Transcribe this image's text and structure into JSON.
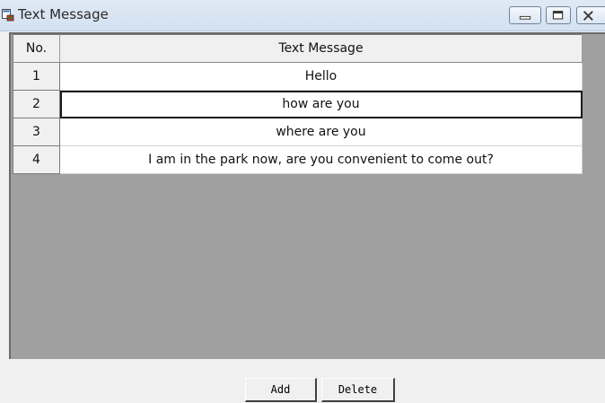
{
  "window": {
    "title": "Text Message",
    "icon": "app-window-icon"
  },
  "titlebar_buttons": {
    "minimize": "minimize-icon",
    "maximize": "maximize-icon",
    "close": "close-icon"
  },
  "table": {
    "headers": [
      "No.",
      "Text Message"
    ],
    "rows": [
      {
        "no": "1",
        "message": "Hello"
      },
      {
        "no": "2",
        "message": "how are you"
      },
      {
        "no": "3",
        "message": "where are you"
      },
      {
        "no": "4",
        "message": "I am in the park now, are you convenient to come out?"
      }
    ],
    "selected_row": 2
  },
  "buttons": {
    "add_label": "Add",
    "delete_label": "Delete"
  },
  "colors": {
    "grid_background": "#a0a0a0",
    "cell_background": "#ffffff",
    "header_background": "#f0f0f0"
  }
}
